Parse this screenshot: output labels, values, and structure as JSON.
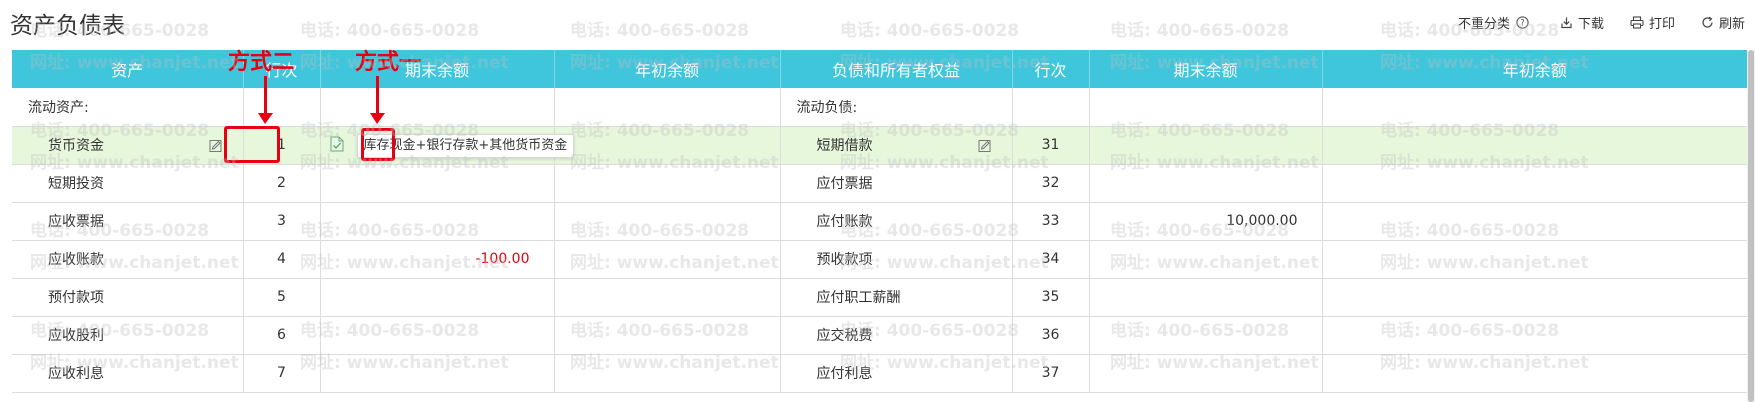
{
  "page": {
    "title": "资产负债表"
  },
  "toolbar": {
    "no_reclass_label": "不重分类",
    "download_label": "下载",
    "print_label": "打印",
    "refresh_label": "刷新",
    "icons": [
      "help-icon",
      "download-icon",
      "print-icon",
      "refresh-icon"
    ]
  },
  "table": {
    "headers": [
      "资产",
      "行次",
      "期末余额",
      "年初余额",
      "负债和所有者权益",
      "行次",
      "期末余额",
      "年初余额"
    ],
    "rows": [
      {
        "asset": "流动资产:",
        "asset_line": "",
        "asset_end": "",
        "asset_begin": "",
        "liab": "流动负债:",
        "liab_line": "",
        "liab_end": "",
        "liab_begin": ""
      },
      {
        "asset": "货币资金",
        "asset_line": "1",
        "asset_end": "",
        "asset_begin": "",
        "liab": "短期借款",
        "liab_line": "31",
        "liab_end": "",
        "liab_begin": ""
      },
      {
        "asset": "短期投资",
        "asset_line": "2",
        "asset_end": "",
        "asset_begin": "",
        "liab": "应付票据",
        "liab_line": "32",
        "liab_end": "",
        "liab_begin": ""
      },
      {
        "asset": "应收票据",
        "asset_line": "3",
        "asset_end": "",
        "asset_begin": "",
        "liab": "应付账款",
        "liab_line": "33",
        "liab_end": "10,000.00",
        "liab_begin": ""
      },
      {
        "asset": "应收账款",
        "asset_line": "4",
        "asset_end": "-100.00",
        "asset_begin": "",
        "liab": "预收款项",
        "liab_line": "34",
        "liab_end": "",
        "liab_begin": ""
      },
      {
        "asset": "预付款项",
        "asset_line": "5",
        "asset_end": "",
        "asset_begin": "",
        "liab": "应付职工薪酬",
        "liab_line": "35",
        "liab_end": "",
        "liab_begin": ""
      },
      {
        "asset": "应收股利",
        "asset_line": "6",
        "asset_end": "",
        "asset_begin": "",
        "liab": "应交税费",
        "liab_line": "36",
        "liab_end": "",
        "liab_begin": ""
      },
      {
        "asset": "应收利息",
        "asset_line": "7",
        "asset_end": "",
        "asset_begin": "",
        "liab": "应付利息",
        "liab_line": "37",
        "liab_end": "",
        "liab_begin": ""
      }
    ],
    "formula_tooltip": "库存现金+银行存款+其他货币资金"
  },
  "annotations": {
    "method_two": "方式二",
    "method_one": "方式一"
  },
  "watermark": {
    "phone": "电话: 400-665-0028",
    "site": "网址: www.chanjet.net"
  },
  "colors": {
    "header_bg": "#3fc6dc",
    "highlight_row": "#e6f7dc",
    "negative": "#e60012",
    "annotation": "#e60012"
  }
}
